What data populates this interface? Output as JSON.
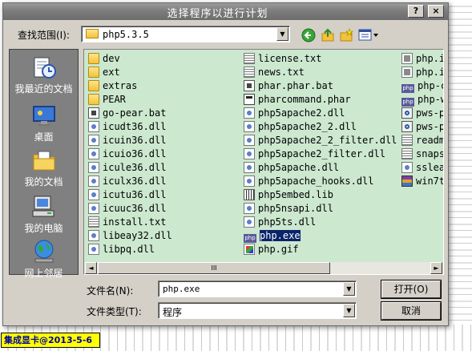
{
  "window": {
    "title": "选择程序以进行计划",
    "help_glyph": "?",
    "close_glyph": "×"
  },
  "toolbar": {
    "look_in_label": "查找范围(I):",
    "look_in_value": "php5.3.5",
    "dropdown_arrow": "▼",
    "icons": [
      "back-icon",
      "up-folder-icon",
      "new-folder-icon",
      "view-menu-icon"
    ]
  },
  "places": [
    {
      "label": "我最近的文档",
      "icon": "recent-documents-icon"
    },
    {
      "label": "桌面",
      "icon": "desktop-icon"
    },
    {
      "label": "我的文档",
      "icon": "my-documents-icon"
    },
    {
      "label": "我的电脑",
      "icon": "my-computer-icon"
    },
    {
      "label": "网上邻居",
      "icon": "network-places-icon"
    }
  ],
  "files": {
    "col1": [
      {
        "name": "dev",
        "type": "folder"
      },
      {
        "name": "ext",
        "type": "folder"
      },
      {
        "name": "extras",
        "type": "folder"
      },
      {
        "name": "PEAR",
        "type": "folder"
      },
      {
        "name": "go-pear.bat",
        "type": "bat"
      },
      {
        "name": "icudt36.dll",
        "type": "dll"
      },
      {
        "name": "icuin36.dll",
        "type": "dll"
      },
      {
        "name": "icuio36.dll",
        "type": "dll"
      },
      {
        "name": "icule36.dll",
        "type": "dll"
      },
      {
        "name": "iculx36.dll",
        "type": "dll"
      },
      {
        "name": "icutu36.dll",
        "type": "dll"
      },
      {
        "name": "icuuc36.dll",
        "type": "dll"
      },
      {
        "name": "install.txt",
        "type": "txt"
      },
      {
        "name": "libeay32.dll",
        "type": "dll"
      },
      {
        "name": "libpq.dll",
        "type": "dll"
      }
    ],
    "col2": [
      {
        "name": "license.txt",
        "type": "txt"
      },
      {
        "name": "news.txt",
        "type": "txt"
      },
      {
        "name": "phar.phar.bat",
        "type": "bat"
      },
      {
        "name": "pharcommand.phar",
        "type": "phar"
      },
      {
        "name": "php5apache2.dll",
        "type": "dll"
      },
      {
        "name": "php5apache2_2.dll",
        "type": "dll"
      },
      {
        "name": "php5apache2_2_filter.dll",
        "type": "dll"
      },
      {
        "name": "php5apache2_filter.dll",
        "type": "dll"
      },
      {
        "name": "php5apache.dll",
        "type": "dll"
      },
      {
        "name": "php5apache_hooks.dll",
        "type": "dll"
      },
      {
        "name": "php5embed.lib",
        "type": "lib"
      },
      {
        "name": "php5nsapi.dll",
        "type": "dll"
      },
      {
        "name": "php5ts.dll",
        "type": "dll"
      },
      {
        "name": "php.exe",
        "type": "php",
        "selected": true
      },
      {
        "name": "php.gif",
        "type": "gif"
      }
    ],
    "col3": [
      {
        "name": "php.i",
        "type": "ini"
      },
      {
        "name": "php.i",
        "type": "ini"
      },
      {
        "name": "php-c",
        "type": "php"
      },
      {
        "name": "php-w",
        "type": "php"
      },
      {
        "name": "pws-p",
        "type": "exe"
      },
      {
        "name": "pws-p",
        "type": "exe"
      },
      {
        "name": "readm",
        "type": "txt"
      },
      {
        "name": "snaps",
        "type": "txt"
      },
      {
        "name": "sslea",
        "type": "dll"
      },
      {
        "name": "win7t",
        "type": "rar"
      }
    ]
  },
  "scrollbar": {
    "left_arrow": "◄",
    "right_arrow": "►",
    "grip": "III"
  },
  "filename": {
    "label": "文件名(N):",
    "value": "php.exe"
  },
  "filetype": {
    "label": "文件类型(T):",
    "value": "程序"
  },
  "buttons": {
    "open": "打开(O)",
    "cancel": "取消"
  },
  "stamp": "集成显卡@2013-5-6"
}
